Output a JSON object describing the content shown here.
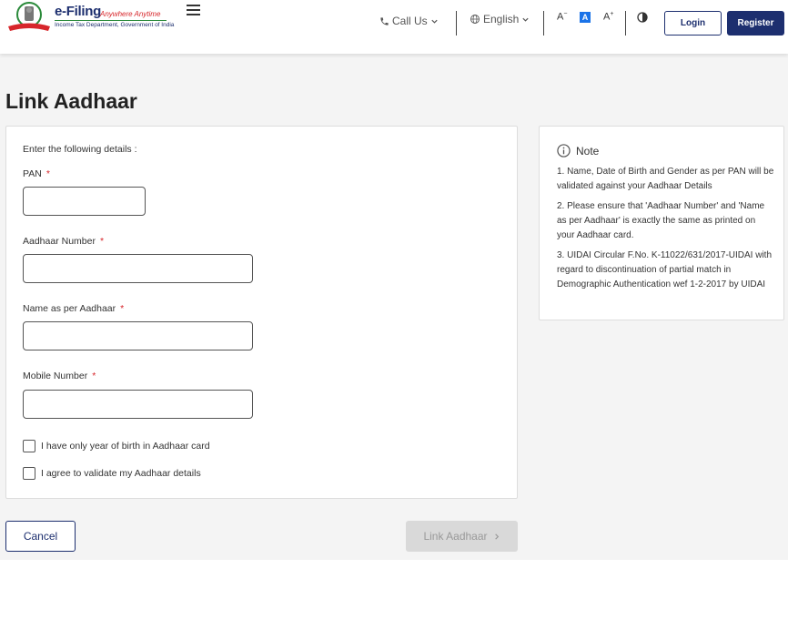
{
  "header": {
    "brand_name": "e-Filing",
    "brand_tagline": "Anywhere Anytime",
    "brand_subtitle": "Income Tax Department, Government of India",
    "call_us": "Call Us",
    "language": "English",
    "font_decrease": "A",
    "font_default": "A",
    "font_increase": "A",
    "login": "Login",
    "register": "Register"
  },
  "page": {
    "title": "Link Aadhaar"
  },
  "form": {
    "intro": "Enter the following details :",
    "required_mark": "*",
    "fields": [
      {
        "label": "PAN",
        "value": ""
      },
      {
        "label": "Aadhaar Number",
        "value": ""
      },
      {
        "label": "Name as per Aadhaar",
        "value": ""
      },
      {
        "label": "Mobile Number",
        "value": ""
      }
    ],
    "checkboxes": [
      {
        "label": "I have only year of birth in Aadhaar card",
        "checked": false
      },
      {
        "label": "I agree to validate my Aadhaar details",
        "checked": false
      }
    ]
  },
  "note": {
    "title": "Note",
    "items": [
      "1. Name, Date of Birth and Gender as per PAN will be validated against your Aadhaar Details",
      "2. Please ensure that 'Aadhaar Number' and 'Name as per Aadhaar' is exactly the same as printed on your Aadhaar card.",
      "3. UIDAI Circular F.No. K-11022/631/2017-UIDAI with regard to discontinuation of partial match in Demographic Authentication wef 1-2-2017 by UIDAI"
    ]
  },
  "actions": {
    "cancel": "Cancel",
    "submit": "Link Aadhaar",
    "submit_enabled": false
  },
  "colors": {
    "brand": "#1d2f6f",
    "accent": "#1a73e8",
    "required": "#d7262b",
    "disabled_bg": "#d9d9d9"
  },
  "icons": {
    "emblem": "national-emblem-icon",
    "menu": "hamburger-icon",
    "phone": "phone-icon",
    "globe": "globe-icon",
    "chevron": "chevron-down-icon",
    "contrast": "contrast-icon",
    "info": "info-icon",
    "next": "chevron-right-icon"
  }
}
